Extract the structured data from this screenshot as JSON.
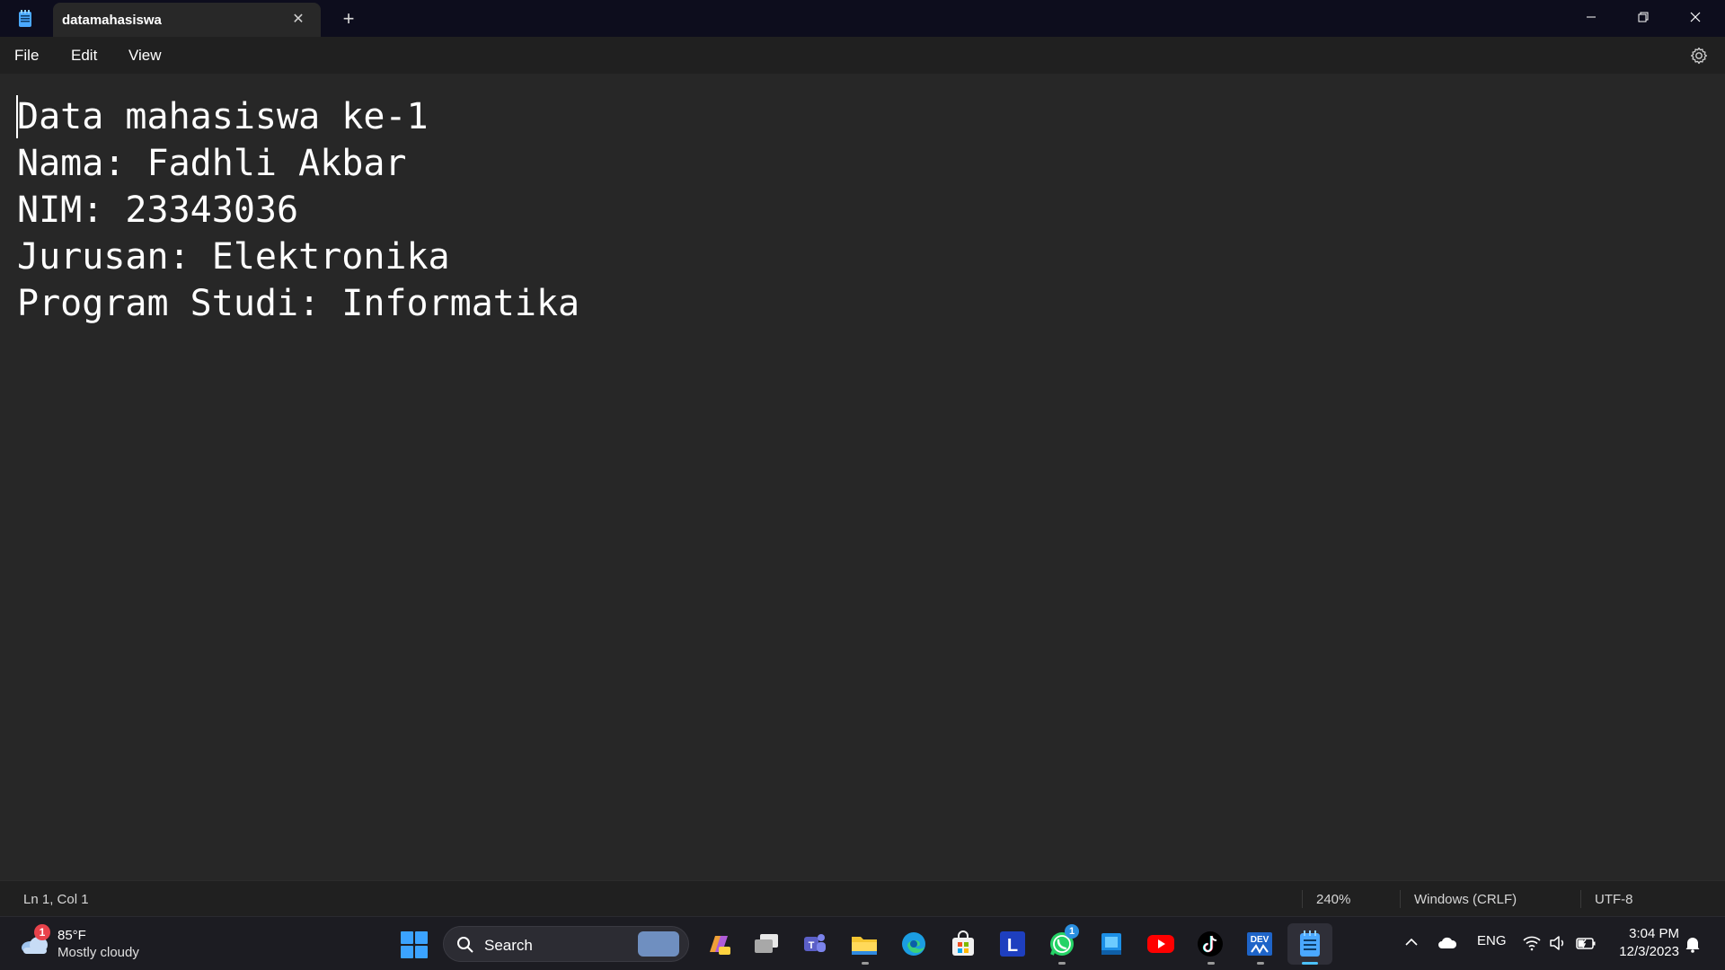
{
  "window": {
    "tab_title": "datamahasiswa",
    "tab_close_icon": "close-icon",
    "new_tab_icon": "plus-icon"
  },
  "menu": {
    "file": "File",
    "edit": "Edit",
    "view": "View"
  },
  "editor": {
    "lines": [
      "Data mahasiswa ke-1",
      "Nama: Fadhli Akbar",
      "NIM: 23343036",
      "Jurusan: Elektronika",
      "Program Studi: Informatika"
    ]
  },
  "status": {
    "position": "Ln 1, Col 1",
    "zoom": "240%",
    "line_ending": "Windows (CRLF)",
    "encoding": "UTF-8"
  },
  "taskbar": {
    "weather_badge": "1",
    "weather_temp": "85°F",
    "weather_desc": "Mostly cloudy",
    "search_label": "Search",
    "whatsapp_badge": "1",
    "tray_language": "ENG",
    "clock_time": "3:04 PM",
    "clock_date": "12/3/2023"
  },
  "colors": {
    "editor_bg": "#272727",
    "titlebar_bg": "#0d0d1d",
    "accent": "#4cc2ff"
  }
}
